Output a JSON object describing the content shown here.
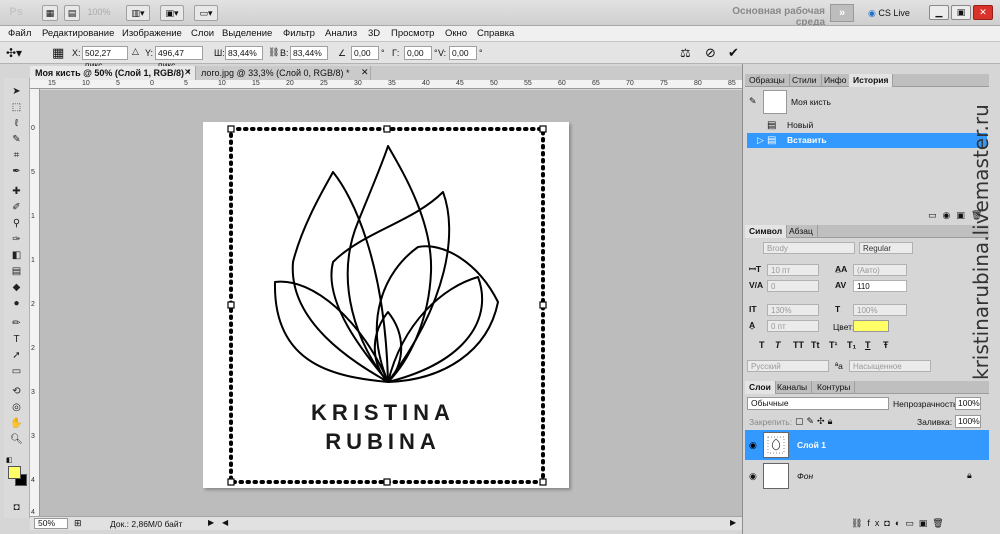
{
  "app": {
    "logo_text": "Ps",
    "zoom_select": "100%",
    "workspace_label": "Основная рабочая среда",
    "workspace_more": "»",
    "cs_live": "CS Live",
    "window_min": "▁",
    "window_restore": "▣",
    "window_close": "✕"
  },
  "menu": [
    "Файл",
    "Редактирование",
    "Изображение",
    "Слои",
    "Выделение",
    "Фильтр",
    "Анализ",
    "3D",
    "Просмотр",
    "Окно",
    "Справка"
  ],
  "options": {
    "x_label": "X:",
    "x_value": "502,27 пикс",
    "y_label": "Y:",
    "y_value": "496,47 пикс",
    "w_label": "Ш:",
    "w_value": "83,44%",
    "h_label": "В:",
    "h_value": "83,44%",
    "angle_value": "0,00",
    "angle_unit": "°",
    "hskew_label": "Г:",
    "hskew_value": "0,00",
    "vskew_label": "V:",
    "vskew_value": "0,00"
  },
  "tabs": [
    {
      "label": "Моя кисть @ 50% (Слой 1, RGB/8) *"
    },
    {
      "label": "лого.jpg @ 33,3% (Слой 0, RGB/8) *"
    }
  ],
  "ruler_top": [
    "15",
    "10",
    "5",
    "0",
    "5",
    "10",
    "15",
    "20",
    "25",
    "30",
    "35",
    "40",
    "45",
    "50",
    "55",
    "60",
    "65",
    "70",
    "75",
    "80",
    "85"
  ],
  "ruler_left": [
    "0",
    "5",
    "1",
    "1",
    "2",
    "2",
    "3",
    "3",
    "4",
    "4"
  ],
  "canvas": {
    "line1": "KRISTINA",
    "line2": "RUBINA"
  },
  "status": {
    "zoom": "50%",
    "doc": "Док.: 2,86M/0 байт"
  },
  "history_panel": {
    "tabs": [
      "Образцы",
      "Стили",
      "Инфо",
      "История"
    ],
    "snapshot": "Моя кисть",
    "steps": [
      "Новый",
      "Вставить"
    ]
  },
  "symbol_panel": {
    "tabs": [
      "Символ",
      "Абзац"
    ],
    "font": "Brody",
    "style": "Regular",
    "size": "10 пт",
    "leading": "(Авто)",
    "kerning": "0",
    "tracking": "110",
    "vscale": "130%",
    "hscale": "100%",
    "baseline": "0 пт",
    "color_label": "Цвет:",
    "color_hex": "#ffff66",
    "type_buttons": [
      "T",
      "T",
      "TT",
      "Tt",
      "T¹",
      "T₁",
      "T",
      "Ŧ"
    ],
    "language": "Русский",
    "aa_prefix": "ªa",
    "antialias": "Насыщенное"
  },
  "layers_panel": {
    "tabs": [
      "Слои",
      "Каналы",
      "Контуры"
    ],
    "blend_mode": "Обычные",
    "opacity_label": "Непрозрачность:",
    "opacity": "100%",
    "lock_label": "Закрепить:",
    "fill_label": "Заливка:",
    "fill": "100%",
    "layers": [
      {
        "name": "Слой 1",
        "selected": true
      },
      {
        "name": "Фон",
        "selected": false
      }
    ]
  },
  "watermark": "kristinarubina.livemaster.ru",
  "colors": {
    "accent": "#3399ff",
    "foreground_swatch": "#ffff66",
    "background_swatch": "#000000"
  }
}
